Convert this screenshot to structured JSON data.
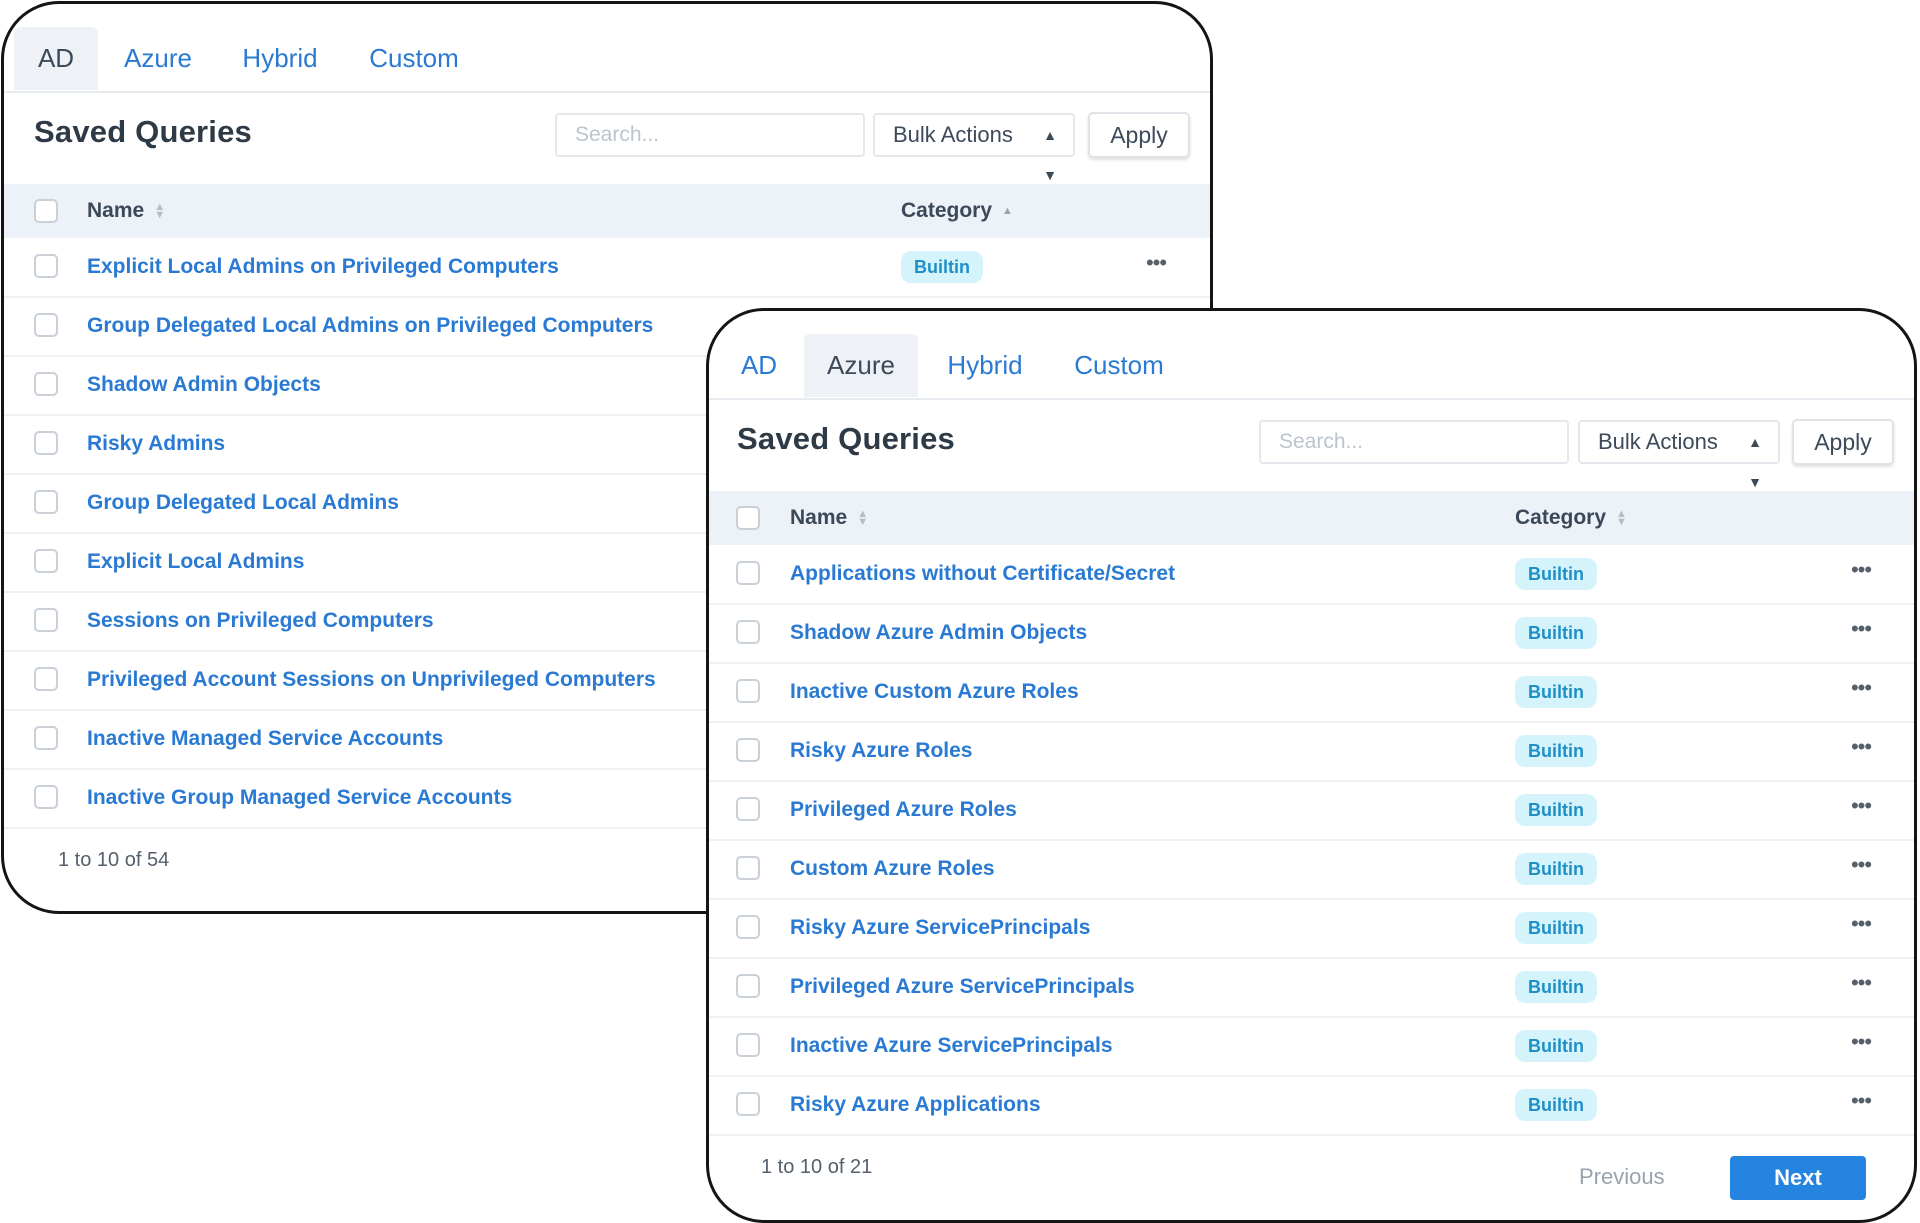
{
  "ad_panel": {
    "tabs": [
      "AD",
      "Azure",
      "Hybrid",
      "Custom"
    ],
    "active_tab": "AD",
    "title": "Saved Queries",
    "search_placeholder": "Search...",
    "bulk_actions_label": "Bulk Actions",
    "apply_label": "Apply",
    "columns": {
      "name": "Name",
      "category": "Category"
    },
    "rows": [
      {
        "name": "Explicit Local Admins on Privileged Computers",
        "category": "Builtin"
      },
      {
        "name": "Group Delegated Local Admins on Privileged Computers"
      },
      {
        "name": "Shadow Admin Objects"
      },
      {
        "name": "Risky Admins"
      },
      {
        "name": "Group Delegated Local Admins"
      },
      {
        "name": "Explicit Local Admins"
      },
      {
        "name": "Sessions on Privileged Computers"
      },
      {
        "name": "Privileged Account Sessions on Unprivileged Computers"
      },
      {
        "name": "Inactive Managed Service Accounts"
      },
      {
        "name": "Inactive Group Managed Service Accounts"
      }
    ],
    "pagination_text": "1 to 10 of 54"
  },
  "azure_panel": {
    "tabs": [
      "AD",
      "Azure",
      "Hybrid",
      "Custom"
    ],
    "active_tab": "Azure",
    "title": "Saved Queries",
    "search_placeholder": "Search...",
    "bulk_actions_label": "Bulk Actions",
    "apply_label": "Apply",
    "columns": {
      "name": "Name",
      "category": "Category"
    },
    "rows": [
      {
        "name": "Applications without Certificate/Secret",
        "category": "Builtin"
      },
      {
        "name": "Shadow Azure Admin Objects",
        "category": "Builtin"
      },
      {
        "name": "Inactive Custom Azure Roles",
        "category": "Builtin"
      },
      {
        "name": "Risky Azure Roles",
        "category": "Builtin"
      },
      {
        "name": "Privileged Azure Roles",
        "category": "Builtin"
      },
      {
        "name": "Custom Azure Roles",
        "category": "Builtin"
      },
      {
        "name": "Risky Azure ServicePrincipals",
        "category": "Builtin"
      },
      {
        "name": "Privileged Azure ServicePrincipals",
        "category": "Builtin"
      },
      {
        "name": "Inactive Azure ServicePrincipals",
        "category": "Builtin"
      },
      {
        "name": "Risky Azure Applications",
        "category": "Builtin"
      }
    ],
    "pagination_text": "1 to 10 of 21",
    "previous_label": "Previous",
    "next_label": "Next"
  },
  "icons": {
    "row_menu": "more-horizontal-icon",
    "bulk_caret": "sort-caret-icon",
    "column_sort": "sort-icon"
  },
  "colors": {
    "link": "#2a7ad3",
    "badge_bg": "#d5f3fb",
    "badge_text": "#1f8fc7",
    "header_bg": "#edf2f8",
    "primary_button": "#2584e0"
  }
}
